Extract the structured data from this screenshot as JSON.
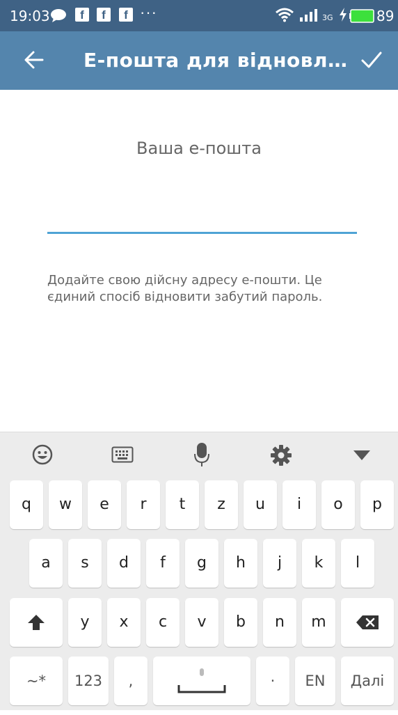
{
  "status_bar": {
    "time": "19:03",
    "fb_letter": "f",
    "more": "···",
    "battery": "89",
    "network": "3G"
  },
  "app_bar": {
    "title": "Е-пошта для відновл…",
    "back_icon": "arrow-left-icon",
    "confirm_icon": "check-icon"
  },
  "form": {
    "email_label": "Ваша е-пошта",
    "email_value": "",
    "hint": "Додайте свою дійсну адресу е-пошти. Це єдиний спосіб відновити забутий пароль."
  },
  "keyboard": {
    "toolbar_icons": [
      "emoji-icon",
      "keyboard-icon",
      "mic-icon",
      "settings-icon",
      "hide-keyboard-icon"
    ],
    "row1": [
      "q",
      "w",
      "e",
      "r",
      "t",
      "z",
      "u",
      "i",
      "o",
      "p"
    ],
    "row2": [
      "a",
      "s",
      "d",
      "f",
      "g",
      "h",
      "j",
      "k",
      "l"
    ],
    "row3": [
      "y",
      "x",
      "c",
      "v",
      "b",
      "n",
      "m"
    ],
    "symbols_key": "~*",
    "numbers_key": "123",
    "comma_key": ",",
    "period_key": "·",
    "language_key": "EN",
    "enter_key": "Далі"
  },
  "colors": {
    "status_bar": "#3f6285",
    "app_bar": "#5485ad",
    "input_underline": "#4fa3d5",
    "keyboard_bg": "#ececec"
  }
}
